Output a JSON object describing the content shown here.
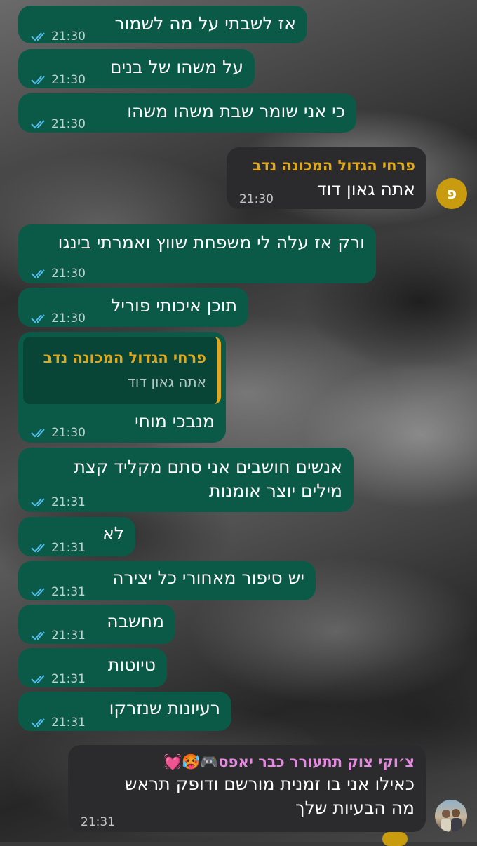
{
  "colors": {
    "outgoing_bubble": "#0b5a47",
    "incoming_bubble": "#2b2b2d",
    "read_ticks": "#53bdeb",
    "sender_gold": "#e0a81d",
    "sender_pink": "#e58ae0"
  },
  "messages": [
    {
      "text": "אז לשבתי על מה לשמור",
      "time": "21:30",
      "status_icon": "double-check-read-icon"
    },
    {
      "text": "על משהו של בנים",
      "time": "21:30",
      "status_icon": "double-check-read-icon"
    },
    {
      "text": "כי אני שומר שבת משהו משהו",
      "time": "21:30",
      "status_icon": "double-check-read-icon"
    },
    {
      "sender": "פרחי הגדול המכונה נדב",
      "avatar_letter": "פ",
      "text": "אתה גאון דוד",
      "time": "21:30"
    },
    {
      "text": "ורק אז עלה לי משפחת שווץ ואמרתי בינגו",
      "time": "21:30",
      "status_icon": "double-check-read-icon"
    },
    {
      "text": "תוכן איכותי פוריל",
      "time": "21:30",
      "status_icon": "double-check-read-icon"
    },
    {
      "quote": {
        "sender": "פרחי הגדול המכונה נדב",
        "text": "אתה גאון דוד"
      },
      "text": "מנבכי מוחי",
      "time": "21:30",
      "status_icon": "double-check-read-icon"
    },
    {
      "lines": [
        "אנשים חושבים אני סתם מקליד קצת",
        "מילים יוצר אומנות"
      ],
      "time": "21:31",
      "status_icon": "double-check-read-icon"
    },
    {
      "text": "לא",
      "time": "21:31",
      "status_icon": "double-check-read-icon"
    },
    {
      "text": "יש סיפור מאחורי כל יצירה",
      "time": "21:31",
      "status_icon": "double-check-read-icon"
    },
    {
      "text": "מחשבה",
      "time": "21:31",
      "status_icon": "double-check-read-icon"
    },
    {
      "text": "טיוטות",
      "time": "21:31",
      "status_icon": "double-check-read-icon"
    },
    {
      "text": "רעיונות שנזרקו",
      "time": "21:31",
      "status_icon": "double-check-read-icon"
    },
    {
      "sender": "צ׳וקי צוק תתעורר כבר יאפס🎮🥵💓",
      "lines": [
        "כאילו אני בו זמנית מורשם ודופק תראש",
        "מה הבעיות שלך"
      ],
      "time": "21:31",
      "avatar": "group-photo-avatar"
    }
  ]
}
